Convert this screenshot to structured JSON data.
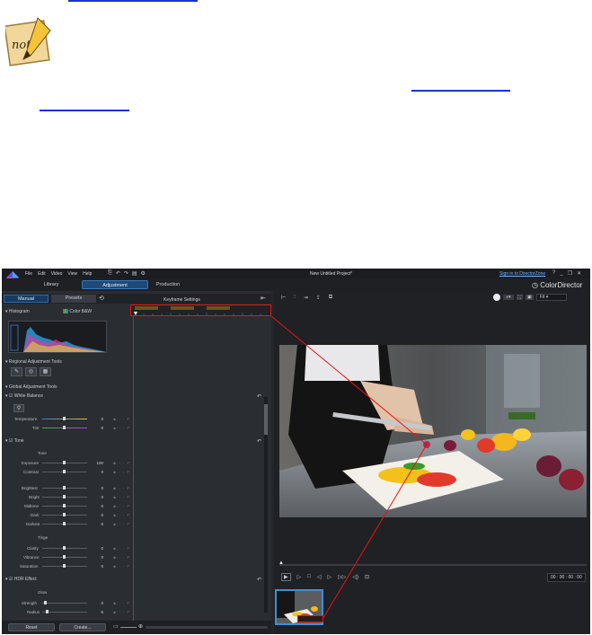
{
  "window": {
    "title": "New Untitled Project*",
    "menu": [
      "File",
      "Edit",
      "Video",
      "View",
      "Help"
    ],
    "sign_in": "Sign in to DirectorZone",
    "brand": "ColorDirector"
  },
  "tabs": [
    "Library",
    "Adjustment",
    "Production"
  ],
  "left_panel": {
    "subtabs": [
      "Manual",
      "Presets"
    ],
    "keyframe_title": "Keyframe Settings",
    "histogram": {
      "label": "Histogram",
      "mode_color": "Color",
      "mode_bw": "B&W"
    },
    "regional_label": "Regional Adjustment Tools",
    "global_label": "Global Adjustment Tools",
    "white_balance": {
      "label": "White Balance",
      "rows": [
        {
          "label": "Temperature",
          "value": "0"
        },
        {
          "label": "Tint",
          "value": "0"
        }
      ]
    },
    "tone": {
      "label": "Tone",
      "tone_heading": "Tone",
      "rows_a": [
        {
          "label": "Exposure",
          "value": "100"
        },
        {
          "label": "Contrast",
          "value": "0"
        }
      ],
      "rows_b": [
        {
          "label": "Brightest",
          "value": "0"
        },
        {
          "label": "Bright",
          "value": "0"
        },
        {
          "label": "Midtone",
          "value": "0"
        },
        {
          "label": "Dark",
          "value": "0"
        },
        {
          "label": "Darkest",
          "value": "0"
        }
      ],
      "tinge_heading": "Tinge",
      "rows_c": [
        {
          "label": "Clarity",
          "value": "0"
        },
        {
          "label": "Vibrance",
          "value": "0"
        },
        {
          "label": "Saturation",
          "value": "0"
        }
      ]
    },
    "hdr": {
      "label": "HDR Effect",
      "glow_heading": "Glow",
      "rows": [
        {
          "label": "Strength",
          "value": "0"
        },
        {
          "label": "Radius",
          "value": "5"
        }
      ]
    },
    "buttons": {
      "reset": "Reset",
      "create": "Create..."
    }
  },
  "right_panel": {
    "timecode": "00 : 00 : 00 : 00",
    "fit": "Fit"
  },
  "colors": {
    "accent": "#1f4a78",
    "highlight_box": "#ee1111",
    "link": "#1a32d8"
  }
}
